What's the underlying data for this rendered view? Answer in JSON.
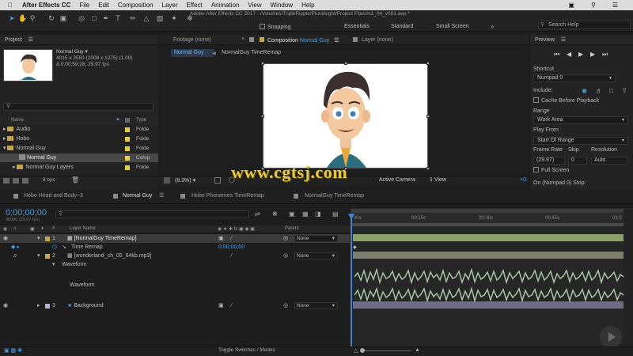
{
  "menubar": {
    "app": "After Effects CC",
    "items": [
      "File",
      "Edit",
      "Composition",
      "Layer",
      "Effect",
      "Animation",
      "View",
      "Window",
      "Help"
    ]
  },
  "window_title": "Adobe After Effects CC 2017 - /Volumes/TripleRipple/Pluralsight/Project Files/m1_04_v001.aep *",
  "toolbar": {
    "snapping": "Snapping",
    "workspaces": [
      "Essentials",
      "Standard",
      "Small Screen"
    ],
    "search_placeholder": "Search Help"
  },
  "project": {
    "title": "Project",
    "item_name": "Normal Guy ▾",
    "item_dims": "4015 x 2550  (2008 x 1275) (1.00)",
    "item_dur": "Δ 0;00;59;28, 29.97 fps",
    "col_name": "Name",
    "col_type": "Type",
    "bpc": "8 bpc",
    "rows": [
      {
        "name": "Audio",
        "type": "Folde"
      },
      {
        "name": "Hobo",
        "type": "Folde"
      },
      {
        "name": "Normal Guy",
        "type": "Folde"
      },
      {
        "name": "Normal Guy",
        "type": "Comp"
      },
      {
        "name": "Normal Guy Layers",
        "type": "Folde"
      }
    ]
  },
  "viewer": {
    "footage_tab": "Footage (none)",
    "comp_tab": "Composition",
    "comp_tab_name": "Normal Guy",
    "layer_tab": "Layer (none)",
    "crumb_1": "Normal Guy",
    "crumb_2": "NormalGuy TimeRemap",
    "zoom": "(8.3%)",
    "camera": "Active Camera",
    "views": "1 View",
    "offset": "+0."
  },
  "preview": {
    "title": "Preview",
    "shortcut_label": "Shortcut",
    "shortcut_value": "Numpad 0",
    "include_label": "Include:",
    "cache_label": "Cache Before Playback",
    "range_label": "Range",
    "range_value": "Work Area",
    "playfrom_label": "Play From",
    "playfrom_value": "Start Of Range",
    "framerate_label": "Frame Rate",
    "skip_label": "Skip",
    "resolution_label": "Resolution",
    "framerate_value": "(29.97)",
    "skip_value": "0",
    "resolution_value": "Auto",
    "fullscreen_label": "Full Screen",
    "on_stop": "On (Numpad 0) Stop:"
  },
  "timeline": {
    "tabs": [
      "Hobo Head and Body~3",
      "Normal Guy",
      "Hobo Phonemes TimeRemap",
      "NormalGuy TimeRemap"
    ],
    "timecode": "0;00;00;00",
    "fps": "00000 (29.97 fps)",
    "col_layer_name": "Layer Name",
    "col_parent": "Parent",
    "ruler": [
      "00s",
      "00:15s",
      "00:30s",
      "00:45s",
      "01:0"
    ],
    "layers": [
      {
        "num": "1",
        "name": "[NormalGuy TimeRemap]",
        "parent": "None",
        "color": "#c9a84a"
      },
      {
        "num": "",
        "name": "Time Remap",
        "value": "0;00;00;00"
      },
      {
        "num": "2",
        "name": "[wonderland_ch_05_64kb.mp3]",
        "parent": "None",
        "color": "#c9a84a"
      },
      {
        "num": "",
        "name": "Waveform"
      },
      {
        "num": "",
        "name": "Waveform"
      },
      {
        "num": "3",
        "name": "Background",
        "parent": "None",
        "color": "#b9b4d6"
      }
    ],
    "toggle": "Toggle Switches / Modes"
  },
  "watermark": "www.cgtsj.com",
  "colors": {
    "accent": "#4a9de0",
    "layer_bar": "#8ea06a",
    "waveform": "#a8c5a2"
  }
}
